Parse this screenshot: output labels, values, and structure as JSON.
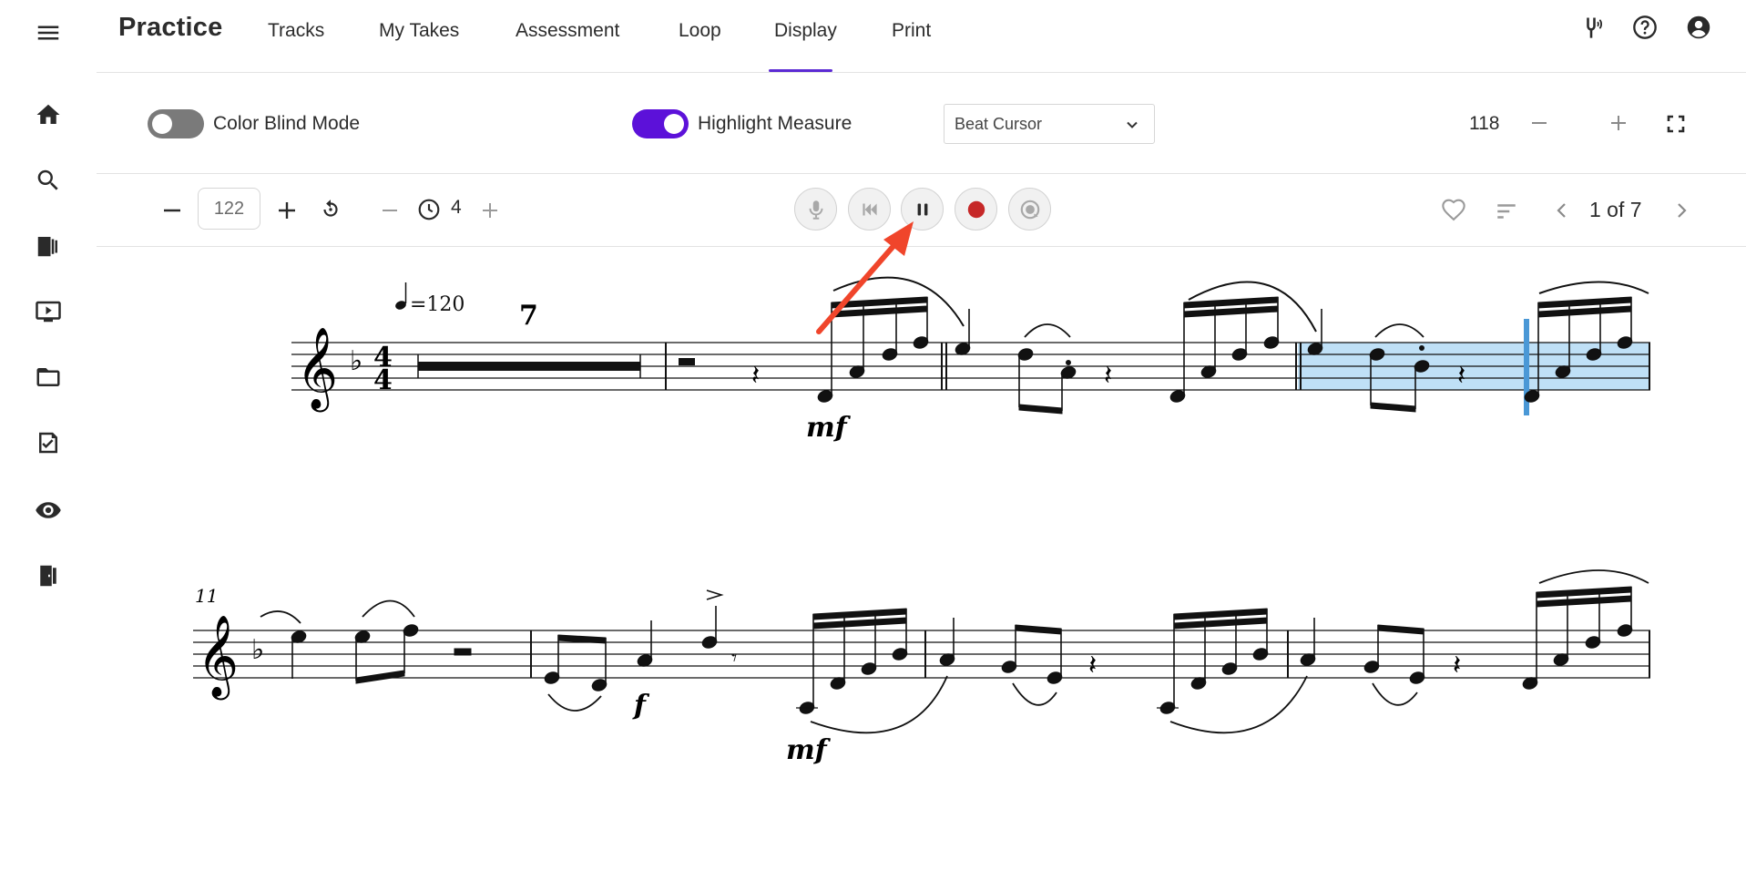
{
  "app": {
    "title": "Practice"
  },
  "tabs": [
    {
      "label": "Tracks"
    },
    {
      "label": "My Takes"
    },
    {
      "label": "Assessment"
    },
    {
      "label": "Loop"
    },
    {
      "label": "Display",
      "active": true
    },
    {
      "label": "Print"
    }
  ],
  "rail": {
    "icons": [
      "menu-icon",
      "home-icon",
      "search-icon",
      "library-icon",
      "video-icon",
      "folder-icon",
      "assignment-icon",
      "eye-icon",
      "exit-icon"
    ]
  },
  "top_actions": {
    "icons": [
      "tuning-fork-icon",
      "help-icon",
      "account-icon"
    ]
  },
  "display": {
    "color_blind_label": "Color Blind Mode",
    "color_blind_on": false,
    "highlight_label": "Highlight Measure",
    "highlight_on": true,
    "cursor_select_value": "Beat Cursor",
    "zoom_value": "118"
  },
  "controls": {
    "tempo_value": "122",
    "count_in_value": "4",
    "page_indicator": "1 of 7",
    "transport_icons": [
      "microphone-icon",
      "skip-back-icon",
      "pause-icon",
      "record-icon",
      "playback-icon"
    ]
  },
  "score": {
    "tempo_marking": "=120",
    "multirest_count": "7",
    "measure_number": "11",
    "dynamics": [
      "mf",
      "f",
      "mf"
    ]
  },
  "colors": {
    "accent": "#5c11d9",
    "record": "#c62828",
    "highlight_fill": "#bfe0f6",
    "cursor_line": "#4a98d6",
    "annotation_arrow": "#f0452b"
  }
}
